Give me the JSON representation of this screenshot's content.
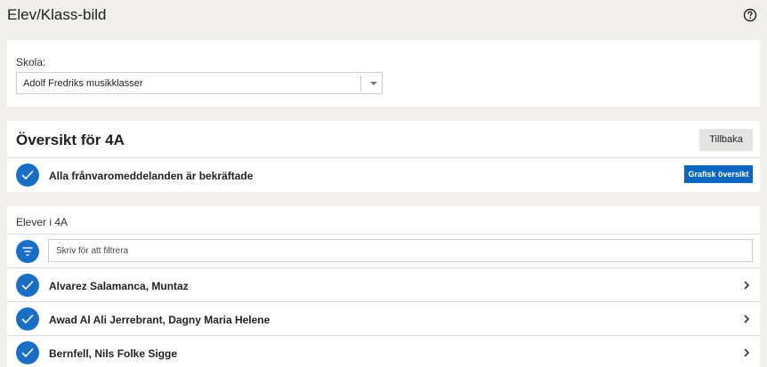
{
  "header": {
    "title": "Elev/Klass-bild",
    "help_icon": "help-circle-icon"
  },
  "school": {
    "label": "Skola:",
    "selected": "Adolf Fredriks musikklasser"
  },
  "overview": {
    "title": "Översikt för 4A",
    "back_label": "Tillbaka",
    "status_text": "Alla frånvaromeddelanden är bekräftade",
    "graphic_button_label": "Grafisk översikt"
  },
  "students": {
    "label": "Elever i 4A",
    "filter_placeholder": "Skriv för att filtrera",
    "items": [
      {
        "name": "Alvarez Salamanca, Muntaz"
      },
      {
        "name": "Awad Al Ali Jerrebrant, Dagny Maria Helene"
      },
      {
        "name": "Bernfell, Nils Folke Sigge"
      }
    ]
  },
  "colors": {
    "accent": "#1a6fc4",
    "button_primary": "#0b66c3",
    "background": "#f0efec"
  }
}
